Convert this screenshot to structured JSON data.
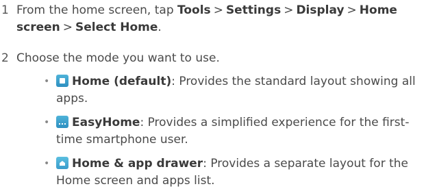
{
  "steps": [
    {
      "number": "1",
      "intro": "From the home screen, tap",
      "path": [
        "Tools",
        "Settings",
        "Display",
        "Home screen",
        "Select Home"
      ],
      "separator": ">",
      "end": "."
    },
    {
      "number": "2",
      "text": "Choose the mode you want to use."
    }
  ],
  "options": [
    {
      "icon": "home-default-icon",
      "title": "Home (default)",
      "desc_line1": ": Provides the standard layout showing all",
      "desc_line2": "apps."
    },
    {
      "icon": "easyhome-icon",
      "title": "EasyHome",
      "desc_line1": ": Provides a simplified experience for the first-",
      "desc_line2": "time smartphone user."
    },
    {
      "icon": "home-app-drawer-icon",
      "title": "Home & app drawer",
      "desc_line1": ": Provides a separate layout for the",
      "desc_line2": "Home screen and apps list."
    }
  ],
  "bullet": "•"
}
